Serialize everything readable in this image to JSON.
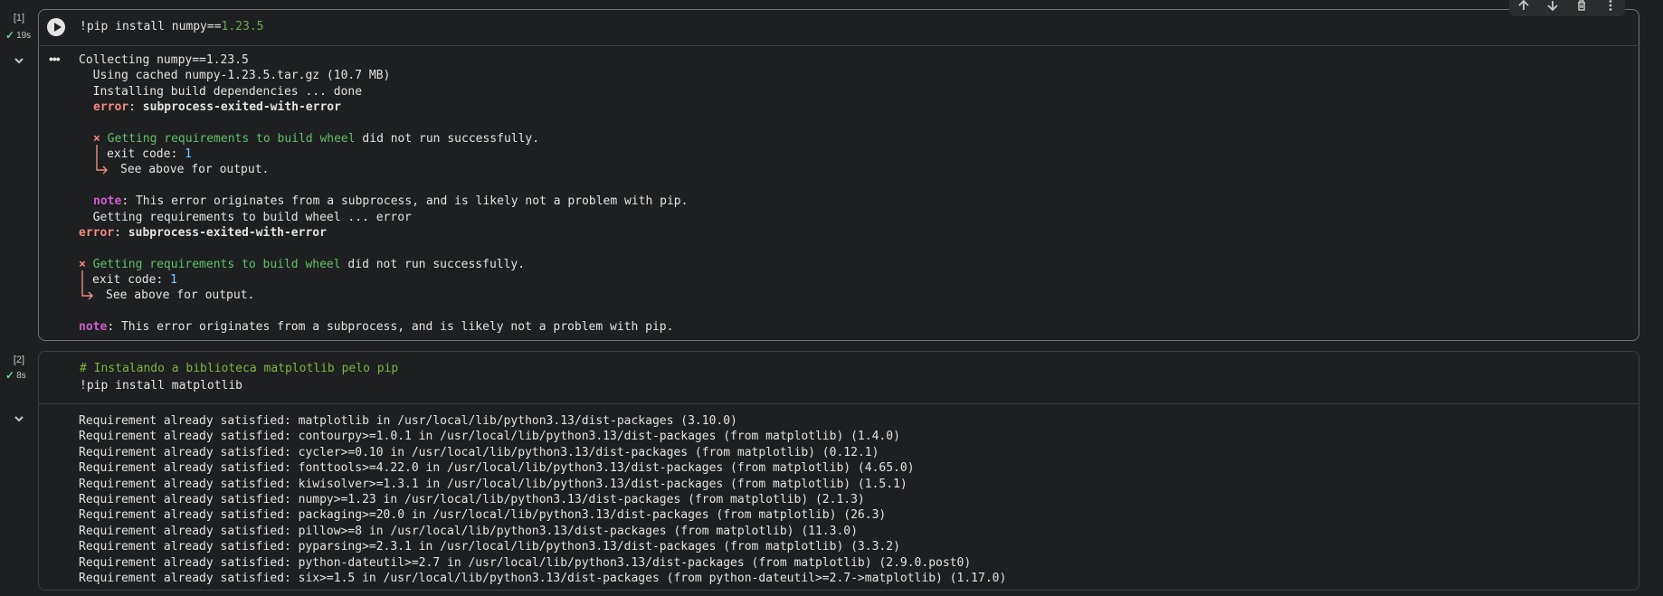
{
  "cell1": {
    "exec_count": "[1]",
    "exec_time": "19s",
    "code": {
      "prefix": "!pip install numpy==",
      "version": "1.23.5"
    },
    "output": {
      "l1": "Collecting numpy==1.23.5",
      "l2": "  Using cached numpy-1.23.5.tar.gz (10.7 MB)",
      "l3": "  Installing build dependencies ... done",
      "l4_a": "error",
      "l4_b": ": ",
      "l4_c": "subprocess-exited-with-error",
      "l6_x": "×",
      "l6_a": "Getting requirements to build wheel",
      "l6_b": " did not run successfully.",
      "l7_a": "exit code: ",
      "l7_b": "1",
      "l8": "See above for output.",
      "l10_a": "note",
      "l10_b": ": This error originates from a subprocess, and is likely not a problem with pip.",
      "l11": "  Getting requirements to build wheel ... error",
      "l12_a": "error",
      "l12_b": ": ",
      "l12_c": "subprocess-exited-with-error",
      "l14_x": "×",
      "l14_a": "Getting requirements to build wheel",
      "l14_b": " did not run successfully.",
      "l15_a": "exit code: ",
      "l15_b": "1",
      "l16": "See above for output.",
      "l18_a": "note",
      "l18_b": ": This error originates from a subprocess, and is likely not a problem with pip."
    }
  },
  "cell2": {
    "exec_count": "[2]",
    "exec_time": "8s",
    "code_comment": "# Instalando a biblioteca matplotlib pelo pip",
    "code_line": "!pip install matplotlib",
    "output": [
      "Requirement already satisfied: matplotlib in /usr/local/lib/python3.13/dist-packages (3.10.0)",
      "Requirement already satisfied: contourpy>=1.0.1 in /usr/local/lib/python3.13/dist-packages (from matplotlib) (1.4.0)",
      "Requirement already satisfied: cycler>=0.10 in /usr/local/lib/python3.13/dist-packages (from matplotlib) (0.12.1)",
      "Requirement already satisfied: fonttools>=4.22.0 in /usr/local/lib/python3.13/dist-packages (from matplotlib) (4.65.0)",
      "Requirement already satisfied: kiwisolver>=1.3.1 in /usr/local/lib/python3.13/dist-packages (from matplotlib) (1.5.1)",
      "Requirement already satisfied: numpy>=1.23 in /usr/local/lib/python3.13/dist-packages (from matplotlib) (2.1.3)",
      "Requirement already satisfied: packaging>=20.0 in /usr/local/lib/python3.13/dist-packages (from matplotlib) (26.3)",
      "Requirement already satisfied: pillow>=8 in /usr/local/lib/python3.13/dist-packages (from matplotlib) (11.3.0)",
      "Requirement already satisfied: pyparsing>=2.3.1 in /usr/local/lib/python3.13/dist-packages (from matplotlib) (3.3.2)",
      "Requirement already satisfied: python-dateutil>=2.7 in /usr/local/lib/python3.13/dist-packages (from matplotlib) (2.9.0.post0)",
      "Requirement already satisfied: six>=1.5 in /usr/local/lib/python3.13/dist-packages (from python-dateutil>=2.7->matplotlib) (1.17.0)"
    ]
  },
  "toolbar": [
    "arrow-up-icon",
    "arrow-down-icon",
    "delete-icon",
    "more-vert-icon"
  ],
  "colors": {
    "background": "#1e1f20",
    "success": "#6dd58c",
    "error": "#f28b82",
    "note": "#d05cd0"
  }
}
